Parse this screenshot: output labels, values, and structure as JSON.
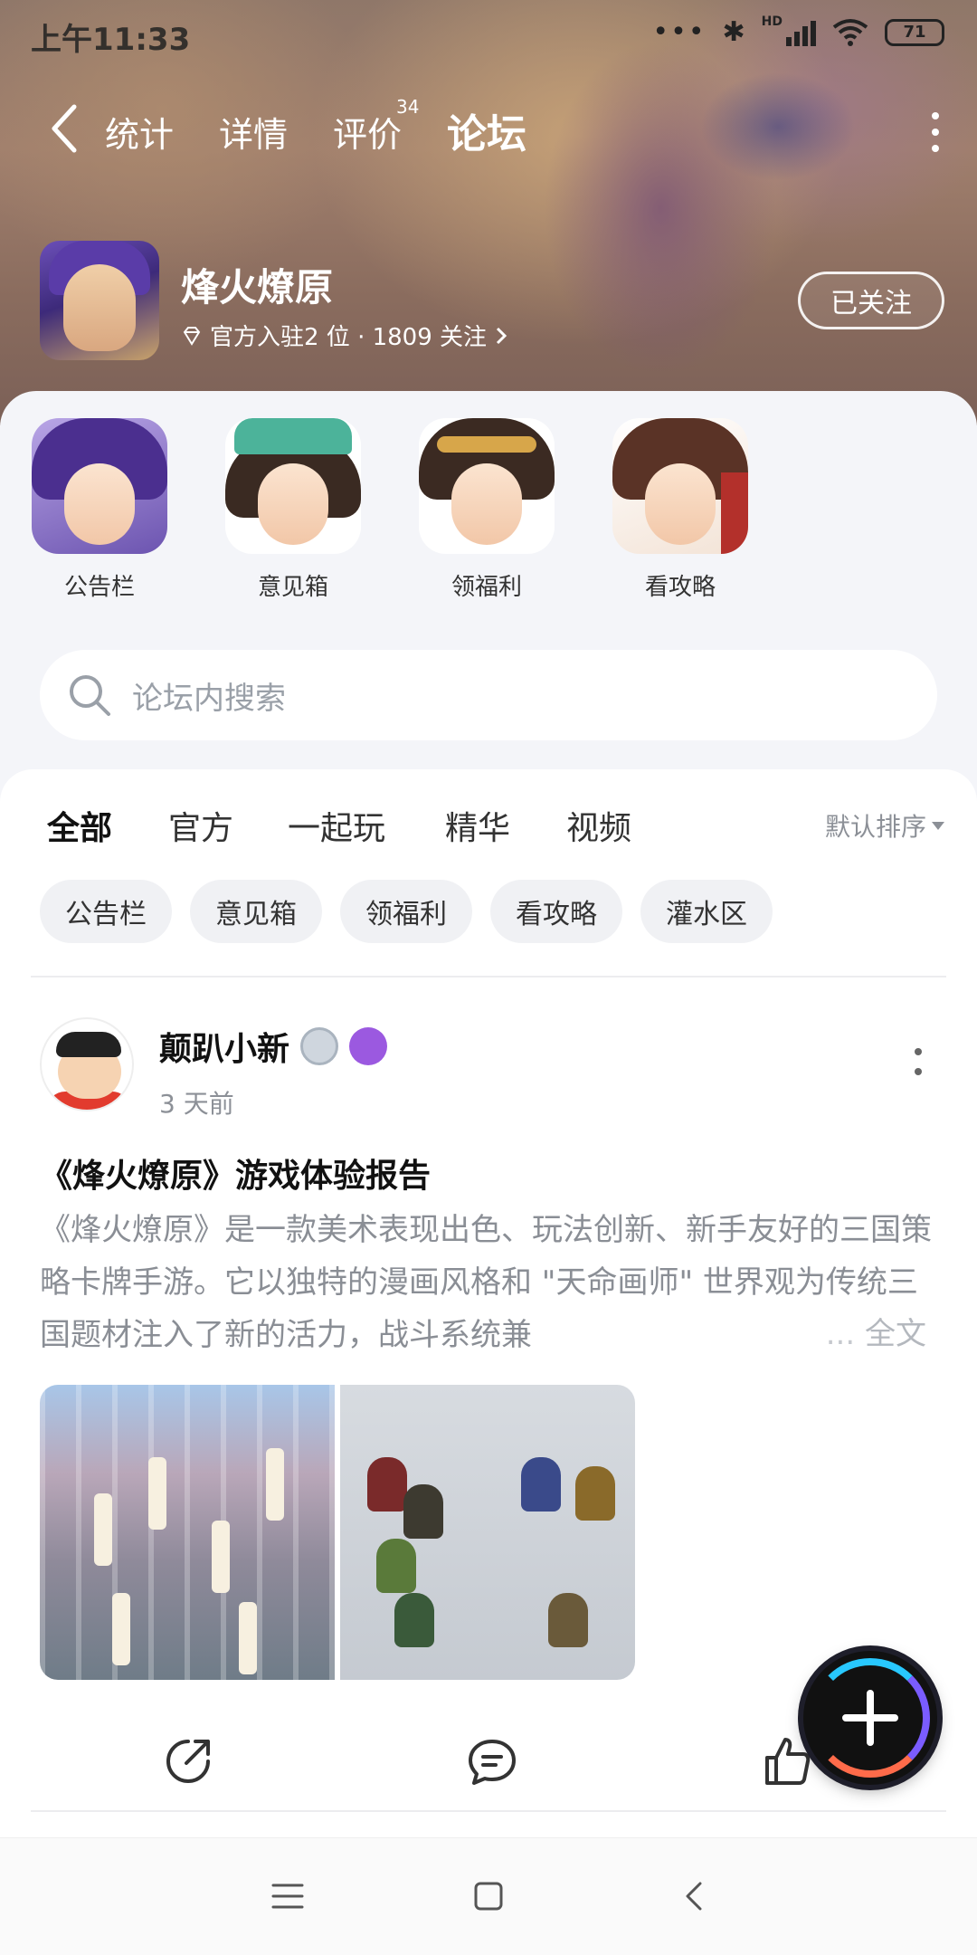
{
  "status_bar": {
    "time": "上午11:33",
    "battery": "71",
    "network_label": "HD"
  },
  "nav": {
    "tabs": [
      {
        "label": "统计"
      },
      {
        "label": "详情"
      },
      {
        "label": "评价",
        "badge": "34"
      },
      {
        "label": "论坛"
      }
    ],
    "active_tab": "论坛"
  },
  "game": {
    "name": "烽火燎原",
    "subtitle": "官方入驻2 位 · 1809 关注",
    "follow_label": "已关注"
  },
  "quick_links": [
    {
      "label": "公告栏"
    },
    {
      "label": "意见箱"
    },
    {
      "label": "领福利"
    },
    {
      "label": "看攻略"
    }
  ],
  "search": {
    "placeholder": "论坛内搜索"
  },
  "feed": {
    "tabs": [
      {
        "label": "全部"
      },
      {
        "label": "官方"
      },
      {
        "label": "一起玩"
      },
      {
        "label": "精华"
      },
      {
        "label": "视频"
      }
    ],
    "active_tab": "全部",
    "sort_label": "默认排序",
    "chips": [
      {
        "label": "公告栏"
      },
      {
        "label": "意见箱"
      },
      {
        "label": "领福利"
      },
      {
        "label": "看攻略"
      },
      {
        "label": "灌水区"
      }
    ]
  },
  "post": {
    "author": "颠趴小新",
    "time": "3 天前",
    "title": "《烽火燎原》游戏体验报告",
    "body": "《烽火燎原》是一款美术表现出色、玩法创新、新手友好的三国策略卡牌手游。它以独特的漫画风格和 \"天命画师\" 世界观为传统三国题材注入了新的活力，战斗系统兼",
    "ellipsis": "...",
    "more_label": "全文"
  },
  "colors": {
    "accent": "#19d3b8",
    "fab": "#111111"
  }
}
